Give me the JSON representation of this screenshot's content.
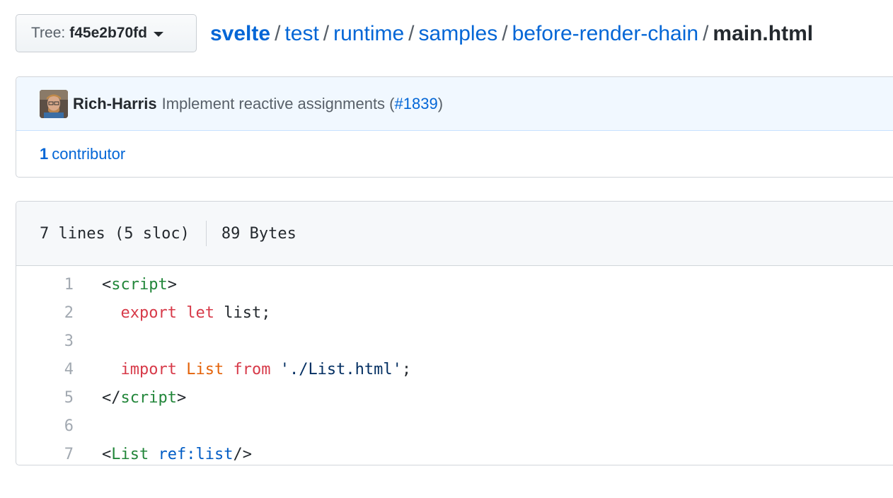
{
  "tree": {
    "label": "Tree:",
    "hash": "f45e2b70fd"
  },
  "breadcrumb": {
    "repo": "svelte",
    "parts": [
      "test",
      "runtime",
      "samples",
      "before-render-chain"
    ],
    "separator": "/",
    "file": "main.html"
  },
  "commit": {
    "author": "Rich-Harris",
    "message": "Implement reactive assignments (",
    "pr": "#1839",
    "message_end": ")"
  },
  "contributors": {
    "count": "1",
    "label": "contributor"
  },
  "file": {
    "lines": "7 lines (5 sloc)",
    "size": "89 Bytes"
  },
  "code": {
    "line_numbers": [
      "1",
      "2",
      "3",
      "4",
      "5",
      "6",
      "7"
    ],
    "l1": {
      "open": "<",
      "tag": "script",
      "close": ">"
    },
    "l2": {
      "kw1": "export",
      "kw2": "let",
      "rest": " list;"
    },
    "l4": {
      "kw": "import",
      "ent": "List",
      "kw2": "from",
      "str": "'./List.html'",
      "end": ";"
    },
    "l5": {
      "open": "</",
      "tag": "script",
      "close": ">"
    },
    "l7": {
      "open": "<",
      "tag": "List",
      "attr": "ref:list",
      "close": "/>"
    }
  },
  "colors": {
    "link": "#0366d6",
    "tag": "#22863a",
    "keyword": "#d73a49",
    "entity": "#e36209",
    "string": "#032f62",
    "attr": "#005cc5"
  },
  "icons": [
    "caret-down-icon",
    "avatar"
  ]
}
